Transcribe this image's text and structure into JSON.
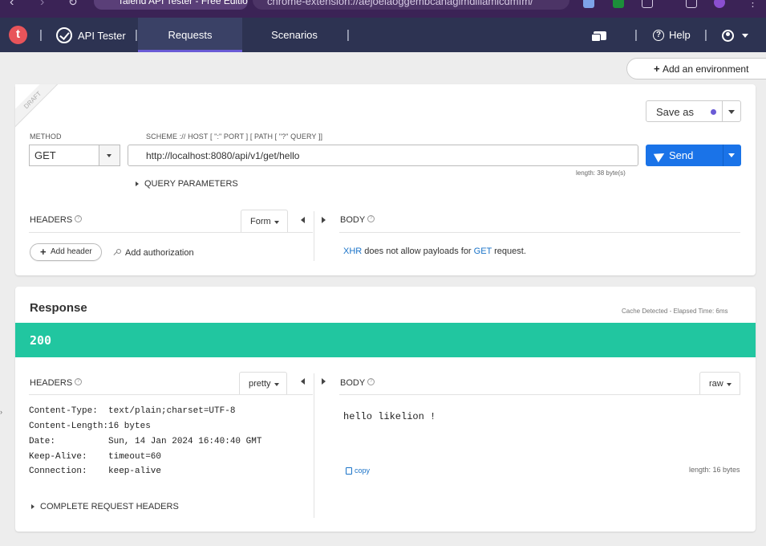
{
  "browser": {
    "tab_title": "Talend API Tester - Free Edition",
    "url": "chrome-extension://aejoelaoggembcahagimdiliamlcdmfm/"
  },
  "navbar": {
    "logo_letter": "t",
    "app_name": "API Tester",
    "tabs": [
      {
        "label": "Requests",
        "active": true
      },
      {
        "label": "Scenarios",
        "active": false
      }
    ],
    "help_label": "Help",
    "separator": "|"
  },
  "environment": {
    "add_label": "Add an environment"
  },
  "request": {
    "draft_label": "DRAFT",
    "save_as_label": "Save as",
    "method_label": "METHOD",
    "method_value": "GET",
    "scheme_label": "SCHEME :// HOST [ \":\" PORT ] [ PATH [ \"?\" QUERY ]]",
    "url_value": "http://localhost:8080/api/v1/get/hello",
    "send_label": "Send",
    "url_length": "length: 38 byte(s)",
    "query_params_label": "QUERY PARAMETERS",
    "headers_label": "HEADERS",
    "headers_mode": "Form",
    "add_header_label": "Add header",
    "add_auth_label": "Add authorization",
    "body_label": "BODY",
    "body_note": {
      "part1": "XHR",
      "part2": " does not allow payloads for ",
      "part3": "GET",
      "part4": " request."
    },
    "info_glyph": "?"
  },
  "response": {
    "title": "Response",
    "elapsed": "Cache Detected - Elapsed Time: 6ms",
    "status_code": "200",
    "status_color": "#21c6a0",
    "headers_label": "HEADERS",
    "headers_mode": "pretty",
    "headers": [
      {
        "key": "Content-Type:",
        "value": "text/plain;charset=UTF-8"
      },
      {
        "key": "Content-Length:",
        "value": "16 bytes"
      },
      {
        "key": "Date:",
        "value": "Sun, 14 Jan 2024 16:40:40 GMT"
      },
      {
        "key": "Keep-Alive:",
        "value": "timeout=60"
      },
      {
        "key": "Connection:",
        "value": "keep-alive"
      }
    ],
    "body_label": "BODY",
    "body_mode": "raw",
    "body_text": "hello likelion !",
    "copy_label": "copy",
    "body_length": "length: 16 bytes",
    "complete_headers_label": "COMPLETE REQUEST HEADERS"
  },
  "colors": {
    "navbar": "#2d3352",
    "accent": "#6a5bd6",
    "send": "#1a73e8",
    "logo": "#e8545a"
  }
}
